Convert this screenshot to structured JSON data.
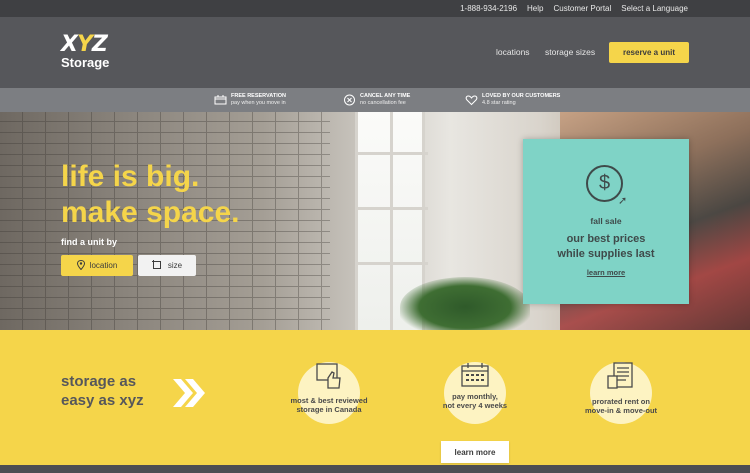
{
  "topbar": {
    "phone": "1-888-934-2196",
    "help": "Help",
    "portal": "Customer Portal",
    "language": "Select a Language"
  },
  "logo": {
    "mark_x": "X",
    "mark_y": "Y",
    "mark_z": "Z",
    "word": "Storage"
  },
  "nav": {
    "locations": "locations",
    "storage_sizes": "storage sizes",
    "reserve": "reserve a unit"
  },
  "features": [
    {
      "icon": "reservation-icon",
      "title": "FREE RESERVATION",
      "sub": "pay when you move in"
    },
    {
      "icon": "cancel-icon",
      "title": "CANCEL ANY TIME",
      "sub": "no cancellation fee"
    },
    {
      "icon": "heart-icon",
      "title": "LOVED BY OUR CUSTOMERS",
      "sub": "4.8 star rating"
    }
  ],
  "hero": {
    "line1": "life is big.",
    "line2": "make space.",
    "find_by": "find a unit by",
    "btn_location": "location",
    "btn_size": "size"
  },
  "promo": {
    "sale": "fall sale",
    "line1": "our best prices",
    "line2": "while supplies last",
    "learn_more": "learn more"
  },
  "benefits": {
    "title1": "storage as",
    "title2": "easy as xyz",
    "items": [
      {
        "icon": "thumbs-up-icon",
        "line1": "most & best reviewed",
        "line2": "storage in Canada"
      },
      {
        "icon": "calendar-icon",
        "line1": "pay monthly,",
        "line2": "not every 4 weeks"
      },
      {
        "icon": "receipt-icon",
        "line1": "prorated rent on",
        "line2": "move-in & move-out"
      }
    ],
    "learn_more": "learn more"
  },
  "colors": {
    "brand_yellow": "#f5d54a",
    "header_gray": "#56575b",
    "promo_teal": "#7fd3c6"
  }
}
